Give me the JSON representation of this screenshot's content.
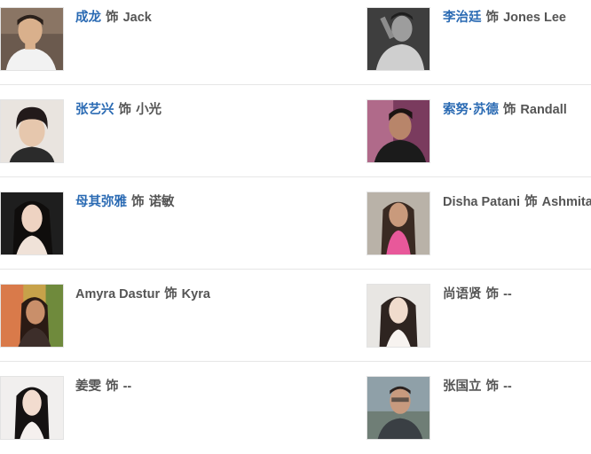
{
  "cast": [
    {
      "actor": "成龙",
      "actor_linked": true,
      "connector": "饰",
      "role": "Jack",
      "photo_icon": "actor-portrait-icon"
    },
    {
      "actor": "李治廷",
      "actor_linked": true,
      "connector": "饰",
      "role": "Jones Lee",
      "photo_icon": "actor-portrait-icon"
    },
    {
      "actor": "张艺兴",
      "actor_linked": true,
      "connector": "饰",
      "role": "小光",
      "photo_icon": "actor-portrait-icon"
    },
    {
      "actor": "索努·苏德",
      "actor_linked": true,
      "connector": "饰",
      "role": "Randall",
      "photo_icon": "actor-portrait-icon"
    },
    {
      "actor": "母其弥雅",
      "actor_linked": true,
      "connector": "饰",
      "role": "诺敏",
      "photo_icon": "actor-portrait-icon"
    },
    {
      "actor": "Disha Patani",
      "actor_linked": false,
      "connector": "饰",
      "role": "Ashmita",
      "photo_icon": "actor-portrait-icon"
    },
    {
      "actor": "Amyra Dastur",
      "actor_linked": false,
      "connector": "饰",
      "role": "Kyra",
      "photo_icon": "actor-portrait-icon"
    },
    {
      "actor": "尚语贤",
      "actor_linked": false,
      "connector": "饰",
      "role": "--",
      "photo_icon": "actor-portrait-icon"
    },
    {
      "actor": "姜雯",
      "actor_linked": false,
      "connector": "饰",
      "role": "--",
      "photo_icon": "actor-portrait-icon"
    },
    {
      "actor": "张国立",
      "actor_linked": false,
      "connector": "饰",
      "role": "--",
      "photo_icon": "actor-portrait-icon"
    }
  ],
  "colors": {
    "link": "#2a6ab3",
    "text": "#555555",
    "divider": "#e6e6e6"
  }
}
